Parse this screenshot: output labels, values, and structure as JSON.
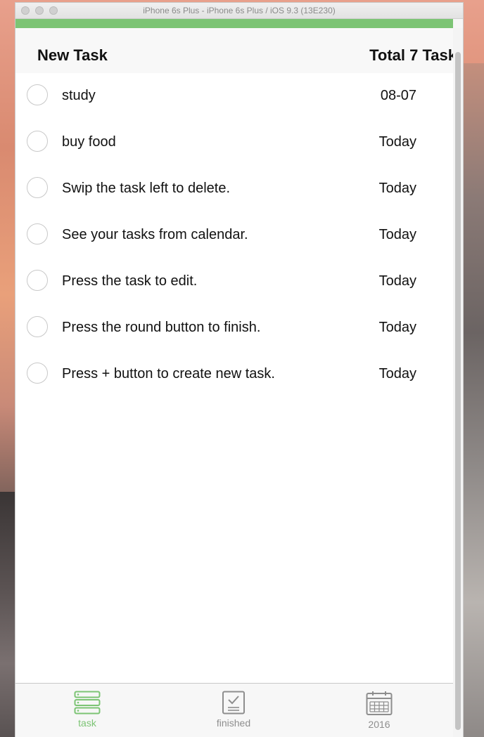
{
  "window": {
    "title": "iPhone 6s Plus - iPhone 6s Plus / iOS 9.3 (13E230)"
  },
  "progress": {
    "fraction": 1.0,
    "color": "#7cc474"
  },
  "nav": {
    "left": "New Task",
    "right": "Total 7 Task"
  },
  "tasks": [
    {
      "text": "study",
      "date": "08-07"
    },
    {
      "text": "buy food",
      "date": "Today"
    },
    {
      "text": "Swip the task left to delete.",
      "date": "Today"
    },
    {
      "text": "See your tasks from calendar.",
      "date": "Today"
    },
    {
      "text": "Press the task to edit.",
      "date": "Today"
    },
    {
      "text": "Press the round button to finish.",
      "date": "Today"
    },
    {
      "text": "Press + button to create new task.",
      "date": "Today"
    }
  ],
  "tabs": [
    {
      "label": "task",
      "icon": "server-stack-icon",
      "active": true
    },
    {
      "label": "finished",
      "icon": "checklist-icon",
      "active": false
    },
    {
      "label": "2016",
      "icon": "calendar-icon",
      "active": false
    }
  ],
  "colors": {
    "accent": "#7cc474",
    "inactive": "#8e8e8e"
  }
}
